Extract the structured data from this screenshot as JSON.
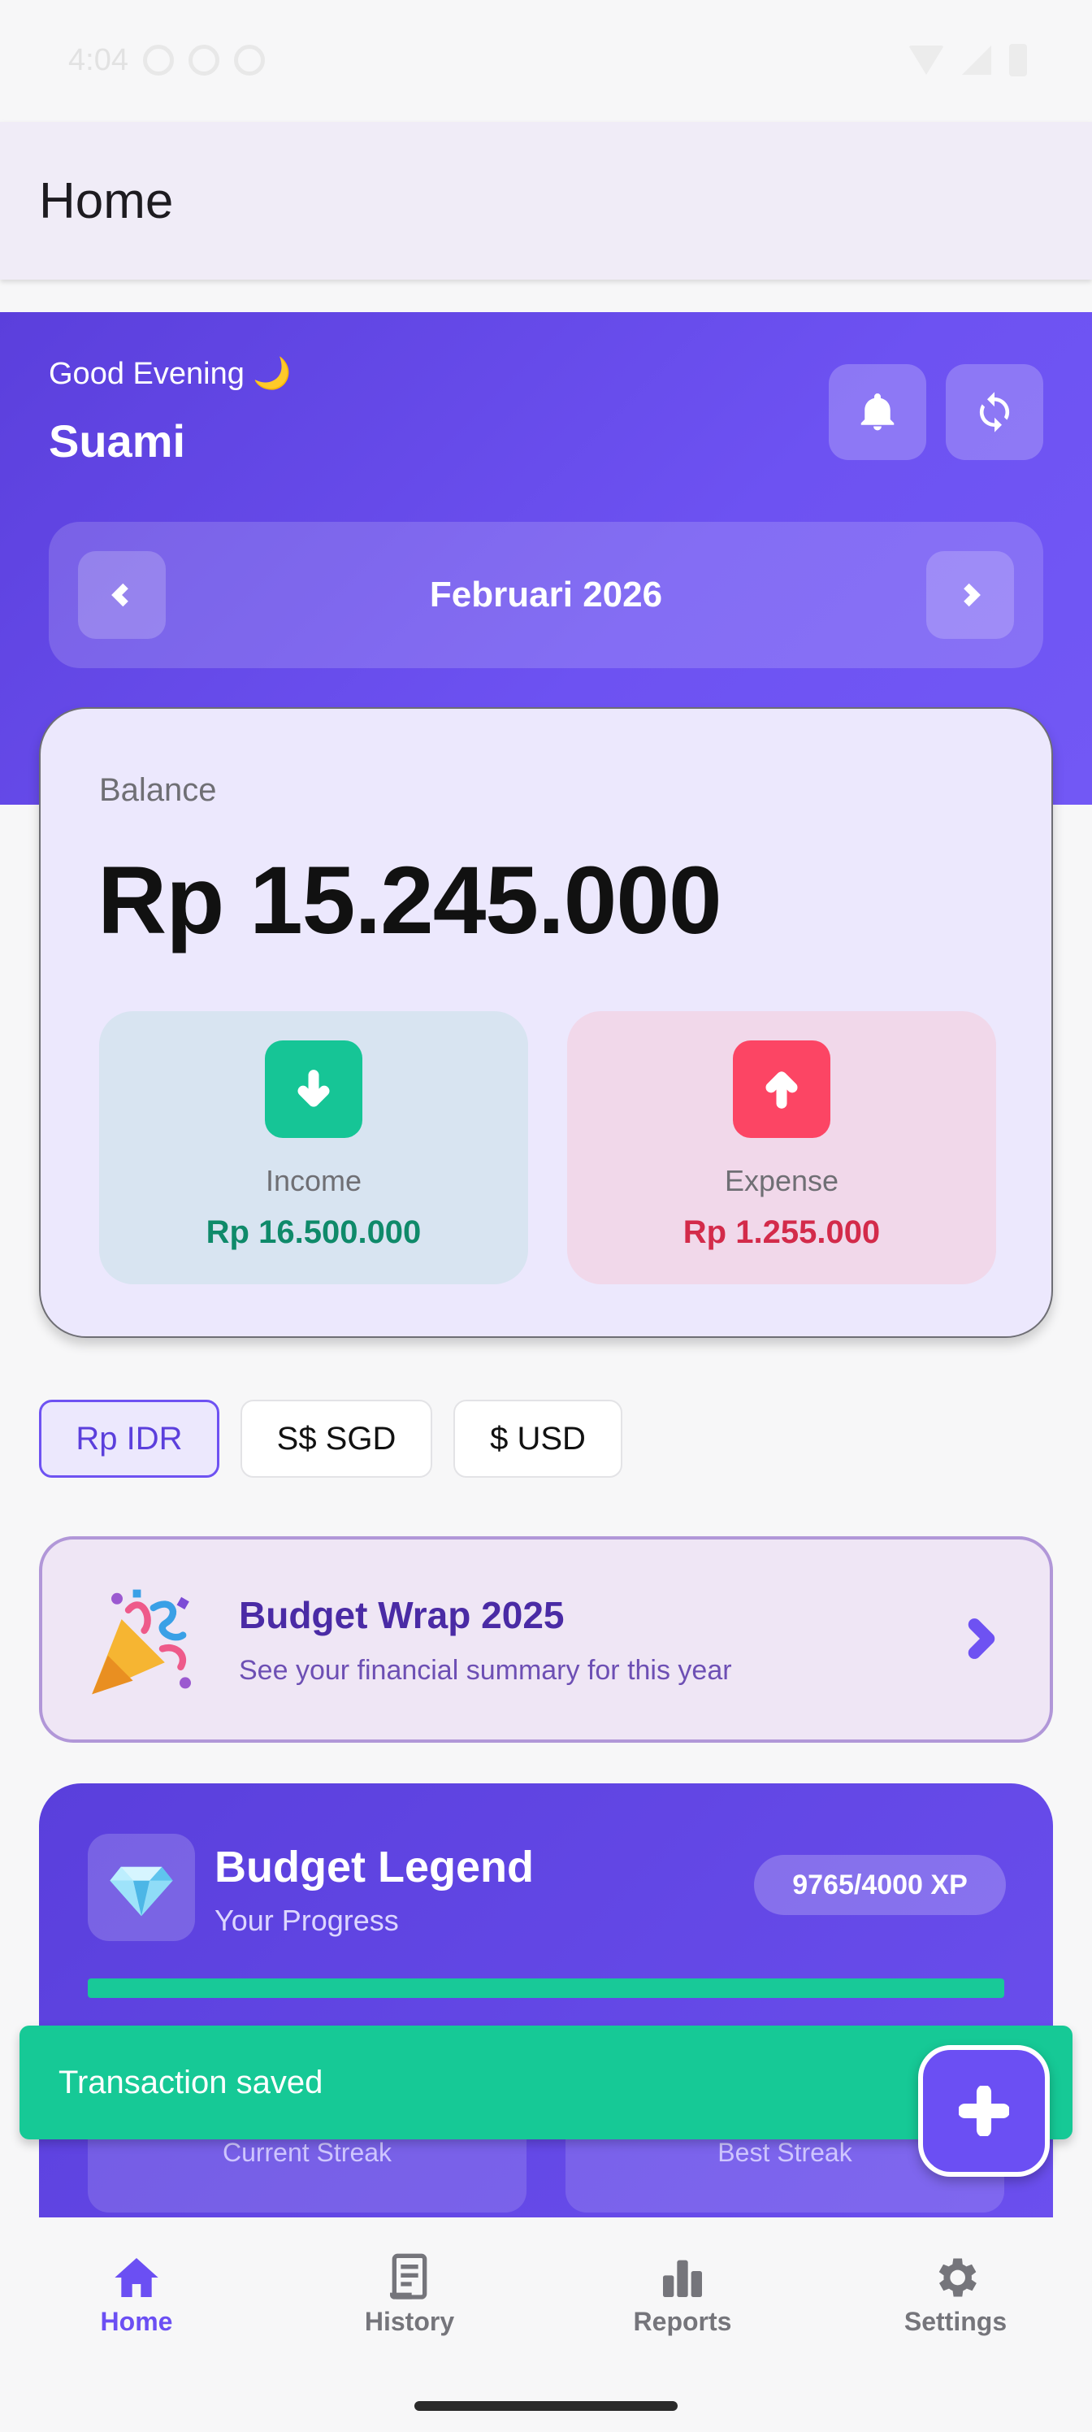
{
  "status_bar": {
    "time": "4:04"
  },
  "app_bar": {
    "title": "Home"
  },
  "hero": {
    "greeting": "Good Evening 🌙",
    "user_name": "Suami",
    "month": "Februari 2026"
  },
  "balance": {
    "label": "Balance",
    "value": "Rp 15.245.000",
    "income": {
      "label": "Income",
      "value": "Rp 16.500.000"
    },
    "expense": {
      "label": "Expense",
      "value": "Rp 1.255.000"
    }
  },
  "currencies": [
    {
      "label": "Rp IDR",
      "active": true
    },
    {
      "label": "S$ SGD",
      "active": false
    },
    {
      "label": "$ USD",
      "active": false
    }
  ],
  "budget_wrap": {
    "title": "Budget Wrap 2025",
    "subtitle": "See your financial summary for this year"
  },
  "legend": {
    "title": "Budget Legend",
    "subtitle": "Your Progress",
    "xp": "9765/4000 XP",
    "progress_fraction": 1.0,
    "current_streak_label": "Current Streak",
    "best_streak_label": "Best Streak"
  },
  "snackbar": {
    "message": "Transaction saved"
  },
  "bottom_nav": [
    {
      "label": "Home",
      "icon": "home-icon",
      "active": true
    },
    {
      "label": "History",
      "icon": "receipt-icon",
      "active": false
    },
    {
      "label": "Reports",
      "icon": "bar-chart-icon",
      "active": false
    },
    {
      "label": "Settings",
      "icon": "gear-icon",
      "active": false
    }
  ],
  "colors": {
    "primary": "#6b4ff3",
    "income": "#16c596",
    "expense": "#fc4564",
    "snackbar": "#16c996"
  }
}
